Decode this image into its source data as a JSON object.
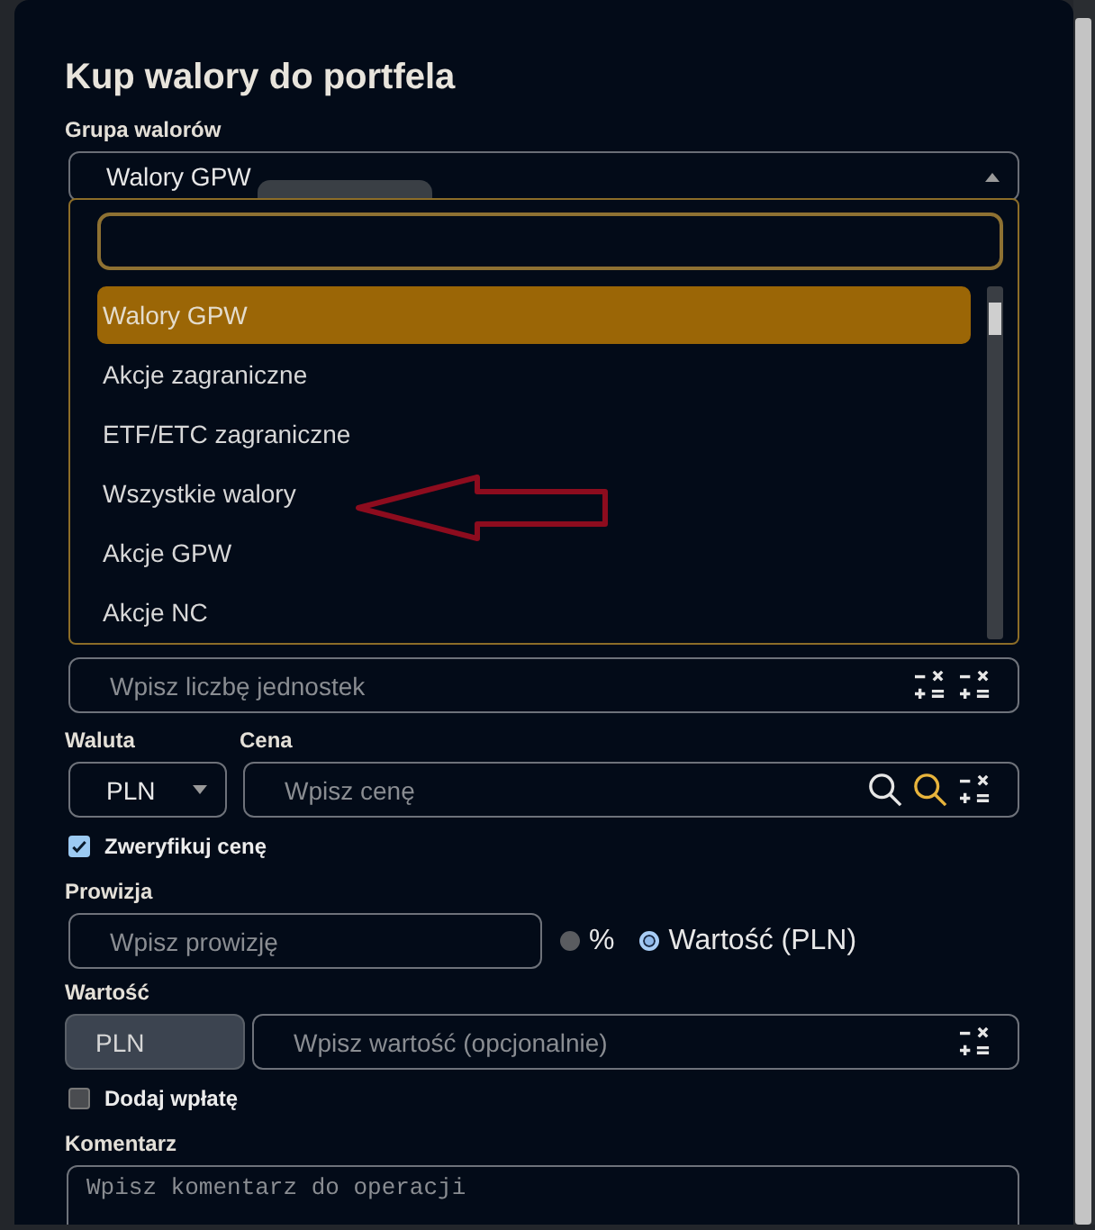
{
  "dialog": {
    "title": "Kup walory do portfela"
  },
  "group": {
    "label": "Grupa walorów",
    "value": "Walory GPW",
    "expanded": true,
    "options": [
      {
        "label": "Walory GPW",
        "selected": true
      },
      {
        "label": "Akcje zagraniczne",
        "selected": false
      },
      {
        "label": "ETF/ETC zagraniczne",
        "selected": false
      },
      {
        "label": "Wszystkie walory",
        "selected": false
      },
      {
        "label": "Akcje GPW",
        "selected": false
      },
      {
        "label": "Akcje NC",
        "selected": false
      }
    ]
  },
  "units": {
    "placeholder": "Wpisz liczbę jednostek"
  },
  "currency": {
    "label": "Waluta",
    "value": "PLN"
  },
  "price": {
    "label": "Cena",
    "placeholder": "Wpisz cenę"
  },
  "verify_price": {
    "label": "Zweryfikuj cenę",
    "checked": true
  },
  "commission": {
    "label": "Prowizja",
    "placeholder": "Wpisz prowizję",
    "modes": [
      {
        "label": "%",
        "selected": false
      },
      {
        "label": "Wartość (PLN)",
        "selected": true
      }
    ]
  },
  "value": {
    "label": "Wartość",
    "currency": "PLN",
    "placeholder": "Wpisz wartość (opcjonalnie)"
  },
  "add_deposit": {
    "label": "Dodaj wpłatę",
    "checked": false
  },
  "comment": {
    "label": "Komentarz",
    "placeholder": "Wpisz komentarz do operacji"
  }
}
